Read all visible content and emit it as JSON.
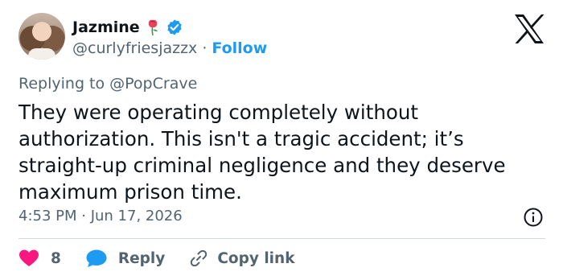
{
  "author": {
    "name": "Jazmine",
    "handle": "@curlyfriesjazzx",
    "separator": "·",
    "follow_label": "Follow",
    "verified_color": "#1d9bf0"
  },
  "reply_context": {
    "prefix": "Replying to ",
    "mention": "@PopCrave"
  },
  "tweet": {
    "text": "They were operating completely without authorization. This isn't a tragic accident; it’s straight-up criminal negligence and they deserve maximum prison time.",
    "timestamp": "4:53 PM · Jun 17, 2026"
  },
  "actions": {
    "like_count": "8",
    "reply_label": "Reply",
    "copy_label": "Copy link"
  },
  "colors": {
    "accent": "#1d9bf0",
    "heart": "#f91880",
    "muted": "#536471",
    "text": "#0f1419"
  }
}
